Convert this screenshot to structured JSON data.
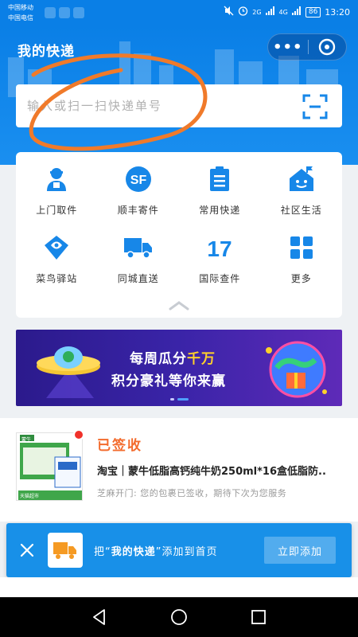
{
  "status_bar": {
    "carrier1": "中国移动",
    "carrier2": "中国电信",
    "net1": "2G",
    "net2": "4G",
    "battery": "86",
    "time": "13:20"
  },
  "header": {
    "title": "我的快递",
    "more_label": "•••"
  },
  "search": {
    "placeholder": "输入或扫一扫快递单号"
  },
  "services": {
    "items": [
      {
        "label": "上门取件",
        "icon": "courier-person-icon"
      },
      {
        "label": "顺丰寄件",
        "icon": "sf-express-icon"
      },
      {
        "label": "常用快递",
        "icon": "clipboard-list-icon"
      },
      {
        "label": "社区生活",
        "icon": "house-flag-icon"
      },
      {
        "label": "菜鸟驿站",
        "icon": "cainiao-bird-icon"
      },
      {
        "label": "同城直送",
        "icon": "delivery-truck-icon"
      },
      {
        "label": "国际查件",
        "icon": "international-17-icon"
      },
      {
        "label": "更多",
        "icon": "grid-more-icon"
      }
    ]
  },
  "banner": {
    "line1_prefix": "每周瓜分",
    "line1_highlight": "千万",
    "line2": "积分豪礼等你来赢"
  },
  "package": {
    "status": "已签收",
    "title": "淘宝｜蒙牛低脂高钙纯牛奶250ml*16盒低脂防..",
    "message": "芝麻开门: 您的包裹已签收，期待下次为您服务",
    "thumb_brand": "蒙牛",
    "thumb_store": "天猫超市"
  },
  "add_bar": {
    "prefix": "把“",
    "app_name": "我的快递",
    "suffix": "”添加到首页",
    "button": "立即添加"
  },
  "colors": {
    "primary_blue": "#0a7fe6",
    "status_orange": "#f36b2d",
    "annotation_orange": "#f07a2a",
    "banner_purple": "#2b1a8c"
  }
}
